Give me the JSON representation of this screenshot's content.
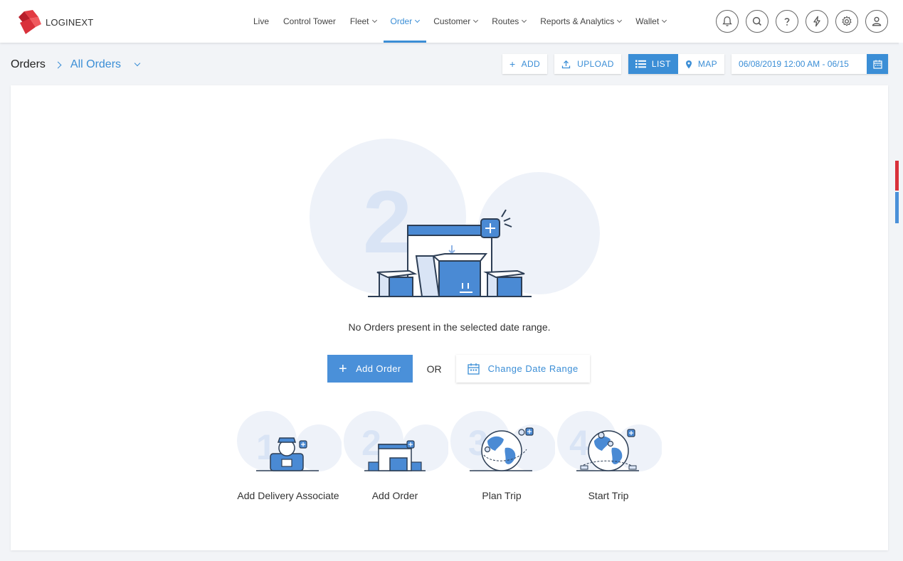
{
  "brand": {
    "name": "LOGINEXT"
  },
  "nav": {
    "items": [
      {
        "label": "Live",
        "dropdown": false
      },
      {
        "label": "Control Tower",
        "dropdown": false
      },
      {
        "label": "Fleet",
        "dropdown": true
      },
      {
        "label": "Order",
        "dropdown": true,
        "active": true
      },
      {
        "label": "Customer",
        "dropdown": true
      },
      {
        "label": "Routes",
        "dropdown": true
      },
      {
        "label": "Reports & Analytics",
        "dropdown": true
      },
      {
        "label": "Wallet",
        "dropdown": true
      }
    ],
    "icons": [
      "bell-icon",
      "search-icon",
      "help-icon",
      "lightning-icon",
      "gear-icon",
      "user-icon"
    ]
  },
  "header": {
    "title": "Orders",
    "view": "All Orders",
    "add_label": "ADD",
    "upload_label": "UPLOAD",
    "list_label": "LIST",
    "map_label": "MAP",
    "date_range": "06/08/2019 12:00 AM - 06/15"
  },
  "empty": {
    "message": "No Orders present in the selected date range.",
    "add_order_label": "Add Order",
    "or_label": "OR",
    "change_range_label": "Change Date Range",
    "hero_number": "2"
  },
  "steps": [
    {
      "number": "1",
      "label": "Add Delivery Associate"
    },
    {
      "number": "2",
      "label": "Add Order"
    },
    {
      "number": "3",
      "label": "Plan Trip"
    },
    {
      "number": "4",
      "label": "Start Trip"
    }
  ],
  "colors": {
    "accent": "#3b8ed6",
    "brand_red": "#d9313b",
    "illustration_blue": "#4a8ad4",
    "bubble": "#eef2f9"
  }
}
